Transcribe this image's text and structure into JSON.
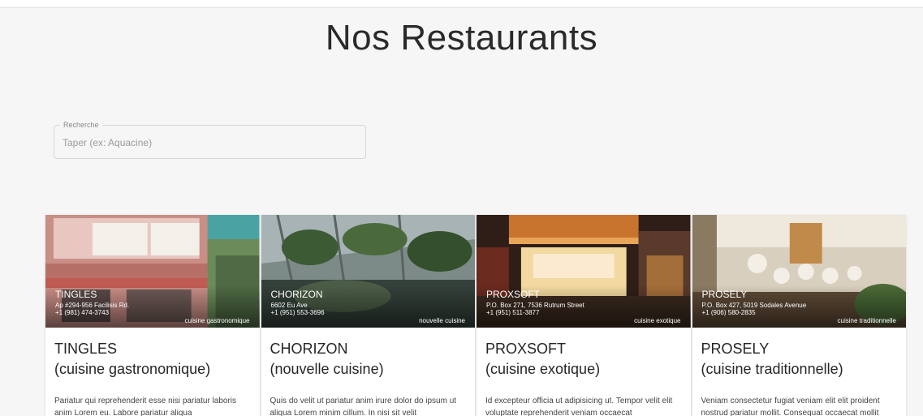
{
  "page": {
    "title": "Nos Restaurants"
  },
  "search": {
    "label": "Recherche",
    "placeholder": "Taper (ex: Aquacine)",
    "value": ""
  },
  "restaurants": [
    {
      "name": "TINGLES",
      "address": "Ap #294-956 Facilisis Rd.",
      "phone": "+1 (981) 474-3743",
      "cuisine": "cuisine gastronomique",
      "title_cuisine": "(cuisine gastronomique)",
      "description": "Pariatur qui reprehenderit esse nisi pariatur laboris anim Lorem eu. Labore pariatur aliqua",
      "image": "laundry-storefront"
    },
    {
      "name": "CHORIZON",
      "address": "6602 Eu Ave",
      "phone": "+1 (951) 553-3696",
      "cuisine": "nouvelle cuisine",
      "title_cuisine": "(nouvelle cuisine)",
      "description": "Quis do velit ut pariatur anim irure dolor do ipsum ut aliqua Lorem minim cillum. In nisi sit velit",
      "image": "greenhouse-dining"
    },
    {
      "name": "PROXSOFT",
      "address": "P.O. Box 271, 7536 Rutrum Street",
      "phone": "+1 (951) 511-3877",
      "cuisine": "cuisine exotique",
      "title_cuisine": "(cuisine exotique)",
      "description": "Id excepteur officia ut adipisicing ut. Tempor velit elit voluptate reprehenderit veniam occaecat",
      "image": "food-stall-night"
    },
    {
      "name": "PROSELY",
      "address": "P.O. Box 427, 5019 Sodales Avenue",
      "phone": "+1 (906) 580-2835",
      "cuisine": "cuisine traditionnelle",
      "title_cuisine": "(cuisine traditionnelle)",
      "description": "Veniam consectetur fugiat veniam elit elit proident nostrud pariatur mollit. Consequat occaecat mollit",
      "image": "bar-taps"
    }
  ]
}
